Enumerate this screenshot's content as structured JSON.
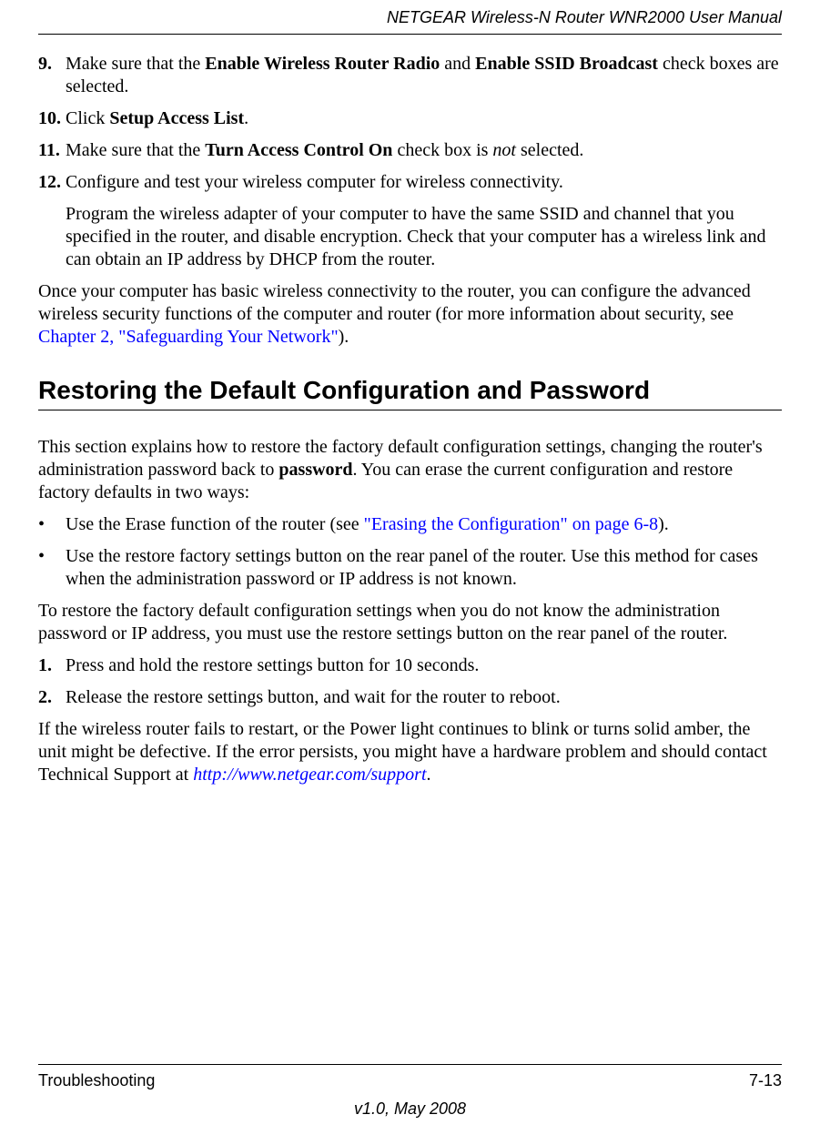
{
  "header": {
    "title": "NETGEAR Wireless-N Router WNR2000 User Manual"
  },
  "steps_first": [
    {
      "marker": "9.",
      "runs": [
        {
          "t": "Make sure that the "
        },
        {
          "t": "Enable Wireless Router Radio",
          "b": true
        },
        {
          "t": " and "
        },
        {
          "t": "Enable SSID Broadcast",
          "b": true
        },
        {
          "t": " check boxes are selected."
        }
      ]
    },
    {
      "marker": "10.",
      "runs": [
        {
          "t": "Click "
        },
        {
          "t": "Setup Access List",
          "b": true
        },
        {
          "t": "."
        }
      ]
    },
    {
      "marker": "11.",
      "runs": [
        {
          "t": "Make sure that the "
        },
        {
          "t": "Turn Access Control On",
          "b": true
        },
        {
          "t": " check box is "
        },
        {
          "t": "not",
          "i": true
        },
        {
          "t": " selected."
        }
      ]
    },
    {
      "marker": "12.",
      "runs": [
        {
          "t": "Configure and test your wireless computer for wireless connectivity."
        }
      ],
      "continuation_runs": [
        {
          "t": "Program the wireless adapter of your computer to have the same SSID and channel that you specified in the router, and disable encryption. Check that your computer has a wireless link and can obtain an IP address by DHCP from the router."
        }
      ]
    }
  ],
  "para_after_steps": {
    "runs": [
      {
        "t": "Once your computer has basic wireless connectivity to the router, you can configure the advanced wireless security functions of the computer and router (for more information about security, see "
      },
      {
        "t": "Chapter 2, \"Safeguarding Your Network\"",
        "link": true
      },
      {
        "t": ")."
      }
    ]
  },
  "section_heading": "Restoring the Default Configuration and Password",
  "section_intro": {
    "runs": [
      {
        "t": "This section explains how to restore the factory default configuration settings, changing the router's administration password back to "
      },
      {
        "t": "password",
        "b": true
      },
      {
        "t": ". You can erase the current configuration and restore factory defaults in two ways:"
      }
    ]
  },
  "bullets": [
    {
      "runs": [
        {
          "t": "Use the Erase function of the router (see "
        },
        {
          "t": "\"Erasing the Configuration\" on page 6-8",
          "link": true
        },
        {
          "t": ")."
        }
      ]
    },
    {
      "runs": [
        {
          "t": "Use the restore factory settings button on the rear panel of the router. Use this method for cases when the administration password or IP address is not known."
        }
      ]
    }
  ],
  "para_restore_intro": "To restore the factory default configuration settings when you do not know the administration password or IP address, you must use the restore settings button on the rear panel of the router.",
  "steps_second": [
    {
      "marker": "1.",
      "runs": [
        {
          "t": "Press and hold the restore settings button for 10 seconds."
        }
      ]
    },
    {
      "marker": "2.",
      "runs": [
        {
          "t": "Release the restore settings button, and wait for the router to reboot."
        }
      ]
    }
  ],
  "closing_para": {
    "runs": [
      {
        "t": "If the wireless router fails to restart, or the Power light continues to blink or turns solid amber, the unit might be defective. If the error persists, you might have a hardware problem and should contact Technical Support at "
      },
      {
        "t": "http://www.netgear.com/support",
        "ital_link": true
      },
      {
        "t": "."
      }
    ]
  },
  "footer": {
    "section": "Troubleshooting",
    "page": "7-13",
    "version": "v1.0, May 2008"
  }
}
